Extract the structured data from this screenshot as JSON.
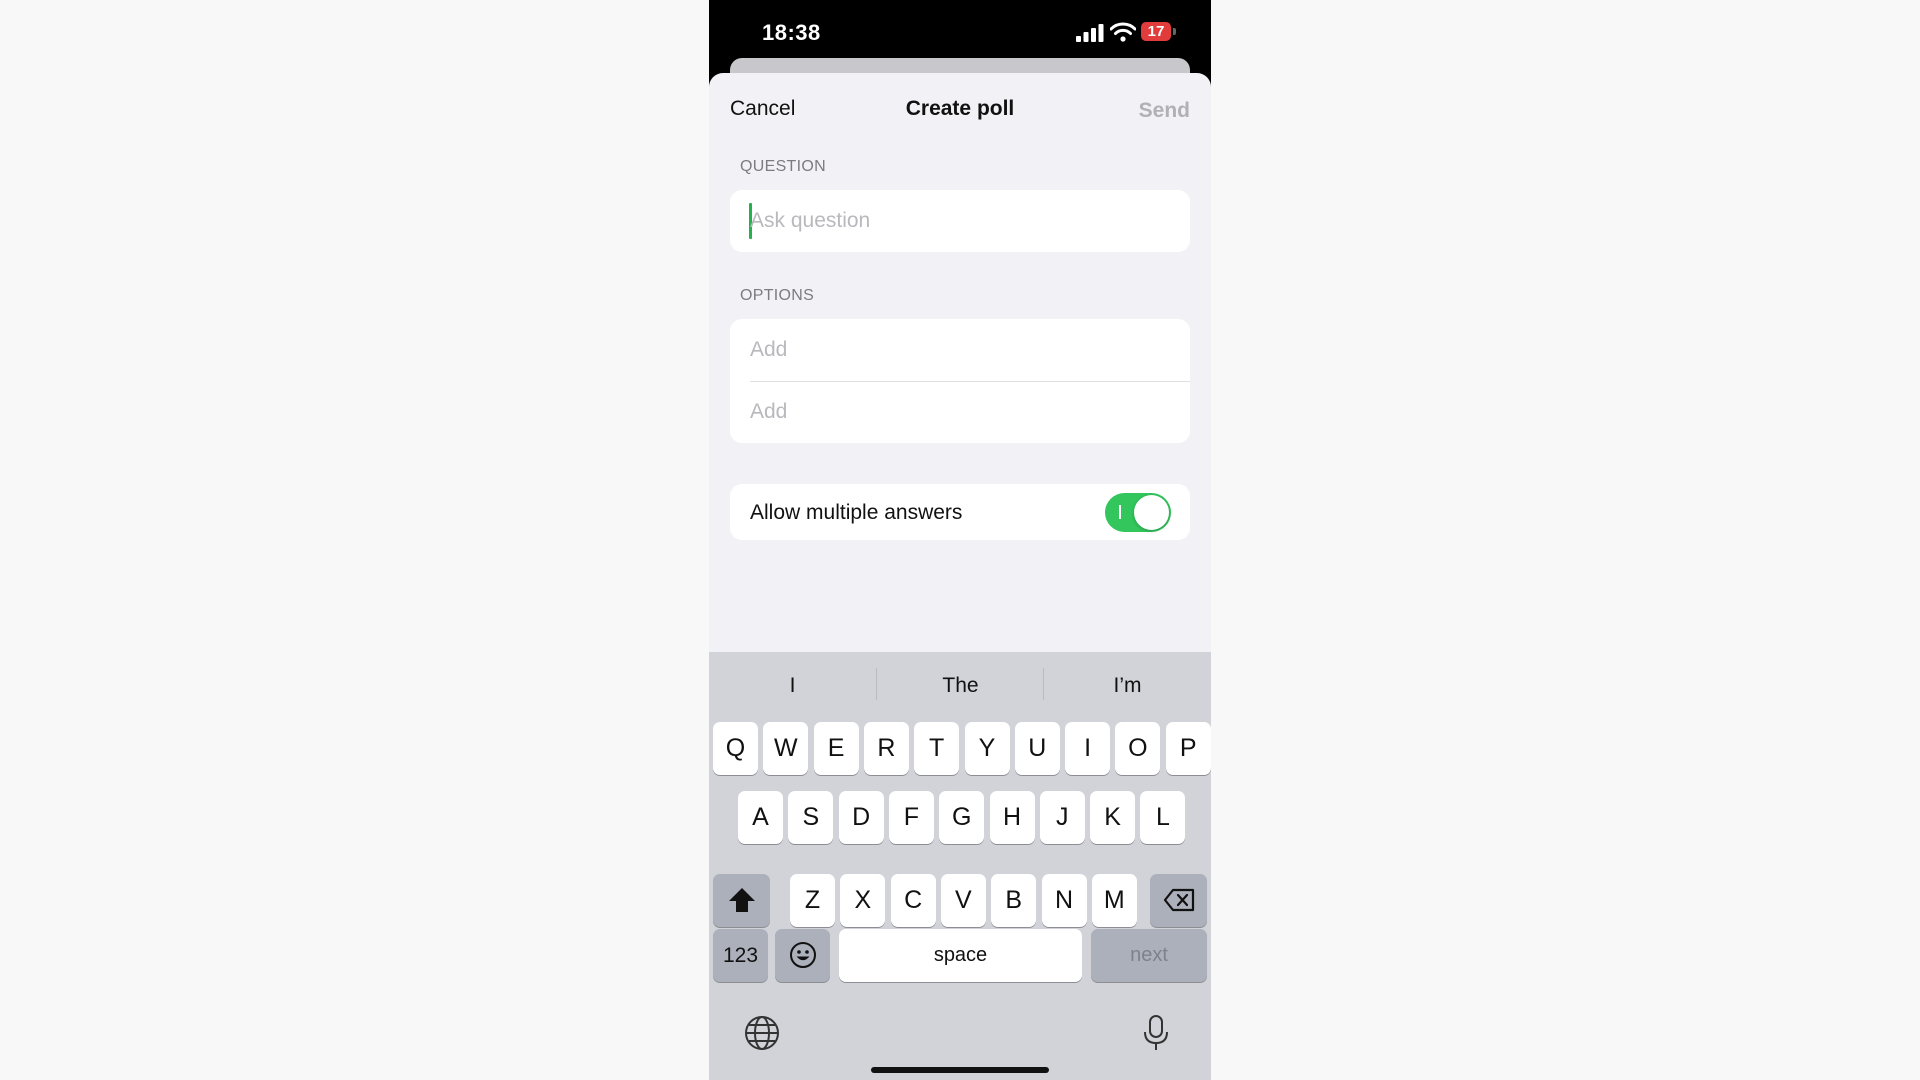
{
  "status": {
    "time": "18:38",
    "battery": "17"
  },
  "nav": {
    "cancel": "Cancel",
    "title": "Create poll",
    "send": "Send"
  },
  "question": {
    "label": "QUESTION",
    "placeholder": "Ask question"
  },
  "options": {
    "label": "OPTIONS",
    "items": [
      {
        "placeholder": "Add"
      },
      {
        "placeholder": "Add"
      }
    ]
  },
  "multiple": {
    "label": "Allow multiple answers",
    "enabled": true
  },
  "keyboard": {
    "suggestions": [
      "I",
      "The",
      "I’m"
    ],
    "row1": [
      "Q",
      "W",
      "E",
      "R",
      "T",
      "Y",
      "U",
      "I",
      "O",
      "P"
    ],
    "row2": [
      "A",
      "S",
      "D",
      "F",
      "G",
      "H",
      "J",
      "K",
      "L"
    ],
    "row3": [
      "Z",
      "X",
      "C",
      "V",
      "B",
      "N",
      "M"
    ],
    "numbers": "123",
    "space": "space",
    "next": "next"
  },
  "colors": {
    "accent": "#32c65c",
    "battery": "#e23b3b"
  }
}
